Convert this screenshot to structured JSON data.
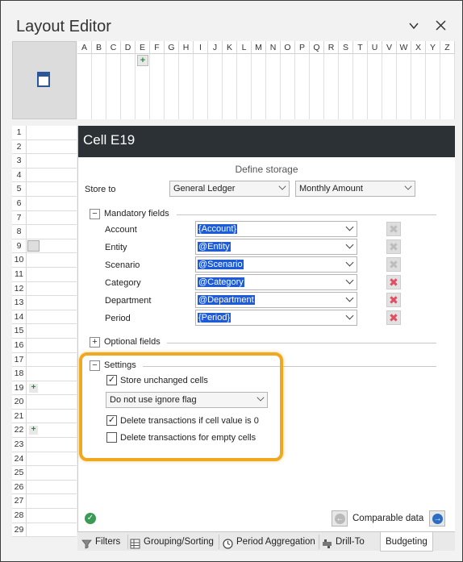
{
  "window": {
    "title": "Layout Editor",
    "chevron_icon": "chevron-down-icon",
    "close_icon": "close-icon"
  },
  "columns": [
    "A",
    "B",
    "C",
    "D",
    "E",
    "F",
    "G",
    "H",
    "I",
    "J",
    "K",
    "L",
    "M",
    "N",
    "O",
    "P",
    "Q",
    "R",
    "S",
    "T",
    "U",
    "V",
    "W",
    "X",
    "Y",
    "Z"
  ],
  "rows": [
    "1",
    "2",
    "3",
    "4",
    "5",
    "6",
    "7",
    "8",
    "9",
    "10",
    "11",
    "12",
    "13",
    "14",
    "15",
    "16",
    "17",
    "18",
    "19",
    "20",
    "21",
    "22",
    "23",
    "24",
    "25",
    "26",
    "27",
    "28",
    "29"
  ],
  "cell": {
    "title": "Cell E19",
    "define_storage": "Define storage",
    "store_to_label": "Store to",
    "store_to_value": "General Ledger",
    "amount_value": "Monthly Amount"
  },
  "mandatory": {
    "section_label": "Mandatory fields",
    "fields": [
      {
        "label": "Account",
        "value": "{Account}",
        "removable": false
      },
      {
        "label": "Entity",
        "value": "@Entity",
        "removable": false
      },
      {
        "label": "Scenario",
        "value": "@Scenario",
        "removable": false
      },
      {
        "label": "Category",
        "value": "@Category",
        "removable": true
      },
      {
        "label": "Department",
        "value": "@Department",
        "removable": true
      },
      {
        "label": "Period",
        "value": "{Period}",
        "removable": true
      }
    ]
  },
  "optional": {
    "section_label": "Optional fields"
  },
  "settings": {
    "section_label": "Settings",
    "store_unchanged": "Store unchanged cells",
    "store_unchanged_checked": true,
    "ignore_flag_value": "Do not use ignore flag",
    "delete_if_zero": "Delete transactions if cell value is 0",
    "delete_if_zero_checked": true,
    "delete_empty": "Delete transactions for empty cells",
    "delete_empty_checked": false,
    "highlight_color": "#f0a81e"
  },
  "footer": {
    "comparable_data": "Comparable data"
  },
  "tabs": [
    {
      "label": "Filters",
      "icon": "filter-icon"
    },
    {
      "label": "Grouping/Sorting",
      "icon": "grouping-icon"
    },
    {
      "label": "Period Aggregation",
      "icon": "clock-icon"
    },
    {
      "label": "Drill-To",
      "icon": "drill-icon"
    },
    {
      "label": "Budgeting",
      "icon": "",
      "active": true
    }
  ],
  "colors": {
    "cell_header_bg": "#2c3136",
    "selection_bg": "#1e5bd8",
    "remove_active": "#e14e63",
    "ok_green": "#3a9b54",
    "nav_blue": "#2b6cc4"
  }
}
